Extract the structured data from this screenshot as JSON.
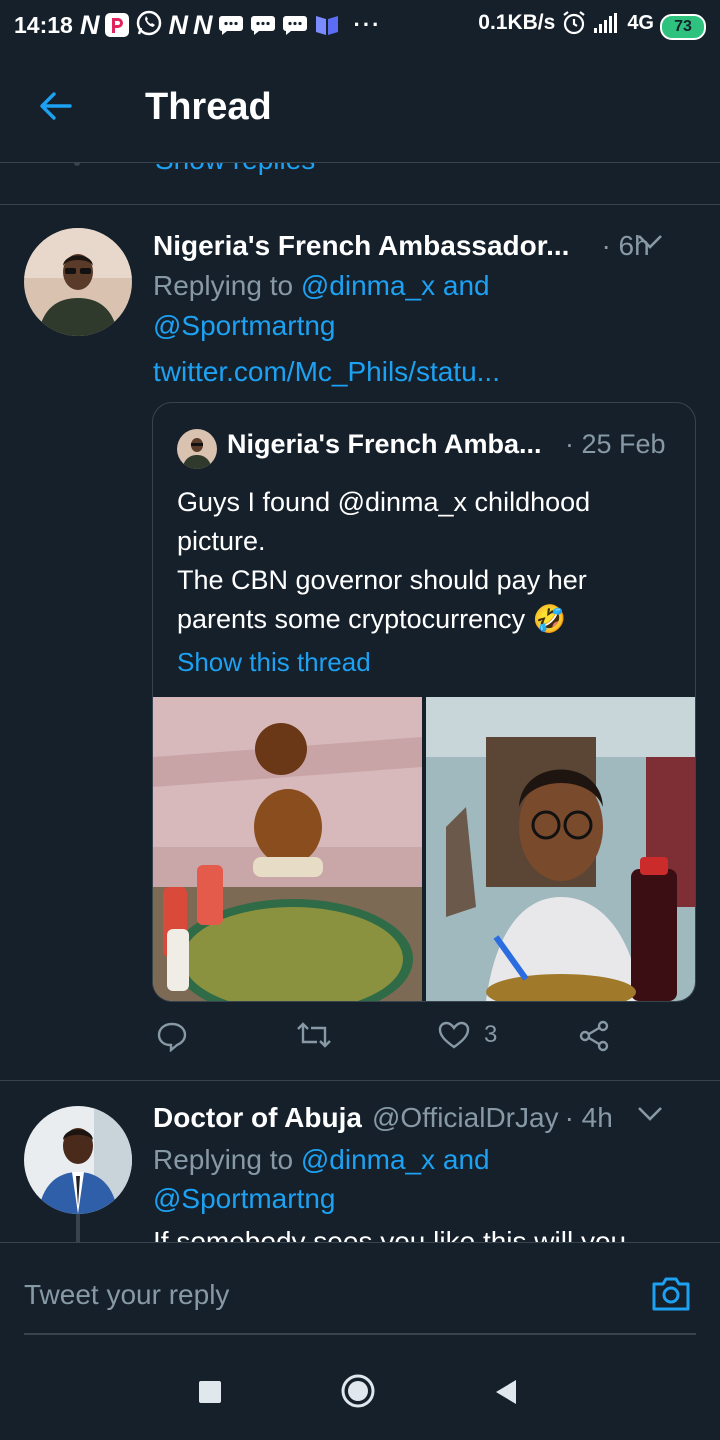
{
  "status_bar": {
    "time": "14:18",
    "app_n": "N",
    "speed": "0.1KB/s",
    "network": "4G",
    "battery": "73",
    "more": "···"
  },
  "header": {
    "title": "Thread"
  },
  "partial_previous": {
    "show_replies": "Show replies"
  },
  "tweet1": {
    "name": "Nigeria's French Ambassador...",
    "time": "· 6h",
    "replying_prefix": "Replying to",
    "mention1": "@dinma_x and",
    "mention2": "@Sportmartng",
    "link": "twitter.com/Mc_Phils/statu...",
    "quote": {
      "name": "Nigeria's French Amba...",
      "date": "· 25 Feb",
      "text_line1": "Guys I found @dinma_x childhood picture.",
      "text_line2": "The CBN governor should pay her parents some cryptocurrency 🤣",
      "show_thread": "Show this thread"
    },
    "likes": "3"
  },
  "tweet2": {
    "name": "Doctor of Abuja",
    "handle": "@OfficialDrJay",
    "time": "· 4h",
    "replying_prefix": "Replying to",
    "mention1": "@dinma_x and",
    "mention2": "@Sportmartng",
    "text_partial": "If somebody sees you like this will you"
  },
  "reply_bar": {
    "placeholder": "Tweet your reply"
  },
  "colors": {
    "background": "#15202b",
    "accent": "#1da1f2",
    "secondary_text": "#8899a6",
    "divider": "#38444d"
  }
}
